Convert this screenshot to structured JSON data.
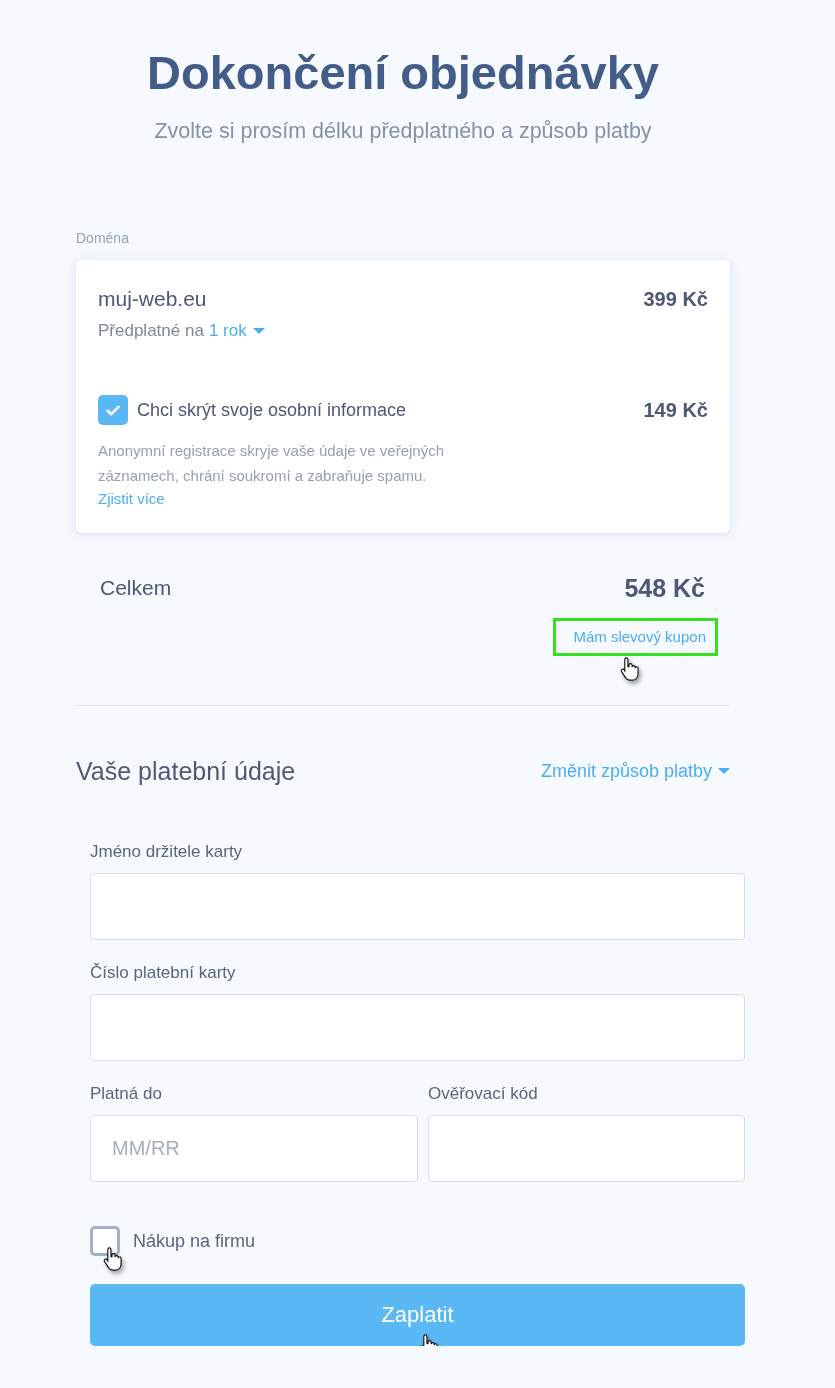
{
  "header": {
    "title": "Dokončení objednávky",
    "subtitle": "Zvolte si prosím délku předplatného a způsob platby"
  },
  "domain_section": {
    "label": "Doména",
    "card": {
      "domain": "muj-web.eu",
      "price": "399 Kč",
      "subscription_label": "Předplatné na",
      "subscription_value": "1 rok",
      "privacy": {
        "label": "Chci skrýt svoje osobní informace",
        "checked": true,
        "price": "149 Kč",
        "description": "Anonymní registrace skryje vaše údaje ve veřejných záznamech, chrání soukromí a zabraňuje spamu.",
        "link": "Zjistit více"
      }
    }
  },
  "total": {
    "label": "Celkem",
    "amount": "548 Kč",
    "coupon_link": {
      "label": "Mám slevový kupon",
      "highlighted": true,
      "hover": true
    }
  },
  "payment": {
    "title": "Vaše platební údaje",
    "change_method": "Změnit způsob platby",
    "fields": [
      {
        "label": "Jméno držitele karty",
        "kind": "full"
      },
      {
        "label": "Číslo platební karty",
        "kind": "full"
      },
      {
        "label": "Platná do",
        "kind": "half",
        "placeholder": "MM/RR"
      },
      {
        "label": "Ověřovací kód",
        "kind": "half"
      }
    ],
    "company_purchase": {
      "label": "Nákup na firmu",
      "checked": false,
      "hover": true
    },
    "pay_button": {
      "label": "Zaplatit",
      "hover": true
    }
  }
}
